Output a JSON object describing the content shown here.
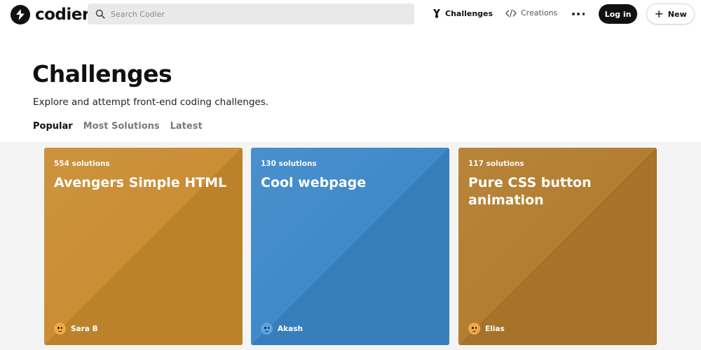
{
  "brand": {
    "name": "codier"
  },
  "search": {
    "placeholder": "Search Codier"
  },
  "nav": {
    "challenges_label": "Challenges",
    "creations_label": "Creations",
    "login_label": "Log in",
    "new_label": "New"
  },
  "page": {
    "title": "Challenges",
    "subtitle": "Explore and attempt front-end coding challenges."
  },
  "tabs": [
    {
      "label": "Popular",
      "active": true
    },
    {
      "label": "Most Solutions",
      "active": false
    },
    {
      "label": "Latest",
      "active": false
    }
  ],
  "cards": [
    {
      "solutions": "554 solutions",
      "title": "Avengers Simple HTML",
      "author": "Sara B",
      "color": "#c88a2e",
      "avatar_color": "#f0a848"
    },
    {
      "solutions": "130 solutions",
      "title": "Cool webpage",
      "author": "Akash",
      "color": "#3a86c8",
      "avatar_color": "#5aa5e0"
    },
    {
      "solutions": "117 solutions",
      "title": "Pure CSS button animation",
      "author": "Elias",
      "color": "#b17a2a",
      "avatar_color": "#f0a848"
    }
  ],
  "icons": {
    "logo": "codier-logo-icon",
    "search": "search-icon",
    "challenges": "trophy-icon",
    "creations": "code-icon",
    "more": "more-horizontal-icon",
    "new": "plus-icon"
  }
}
